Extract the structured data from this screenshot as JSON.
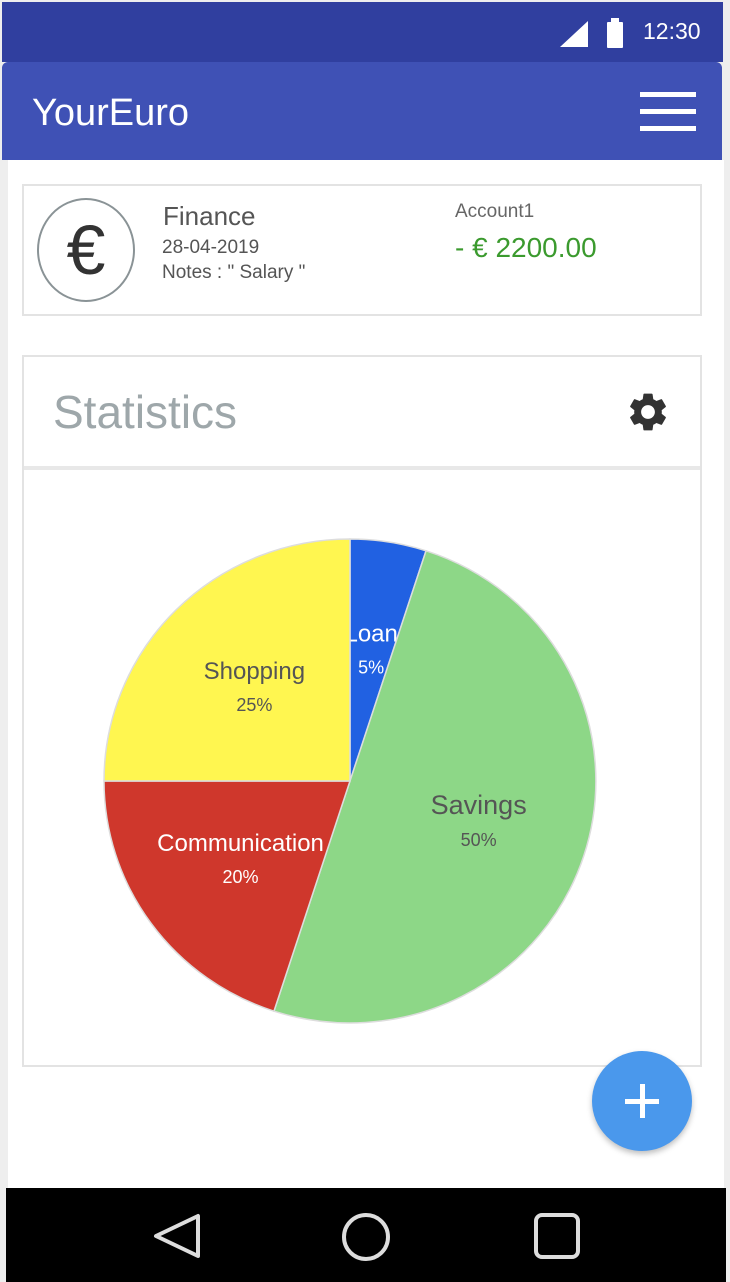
{
  "status_bar": {
    "time": "12:30",
    "icons": [
      "signal-icon",
      "battery-icon"
    ]
  },
  "app_bar": {
    "title": "YourEuro",
    "menu_icon": "menu-icon"
  },
  "transaction": {
    "icon": "euro-icon",
    "category": "Finance",
    "date": "28-04-2019",
    "notes": "Notes : \" Salary  \"",
    "account": "Account1",
    "amount": "- € 2200.00"
  },
  "statistics": {
    "title": "Statistics",
    "settings_icon": "gear-icon"
  },
  "chart_data": {
    "type": "pie",
    "categories": [
      "Loan",
      "Savings",
      "Communication",
      "Shopping"
    ],
    "values": [
      5,
      50,
      20,
      25
    ],
    "labels": [
      "5%",
      "50%",
      "20%",
      "25%"
    ],
    "colors": [
      "#2161e2",
      "#8dd787",
      "#cf372c",
      "#fff650"
    ]
  },
  "fab": {
    "icon": "plus-icon"
  },
  "nav_bar": {
    "icons": [
      "back-icon",
      "home-icon",
      "recents-icon"
    ]
  }
}
